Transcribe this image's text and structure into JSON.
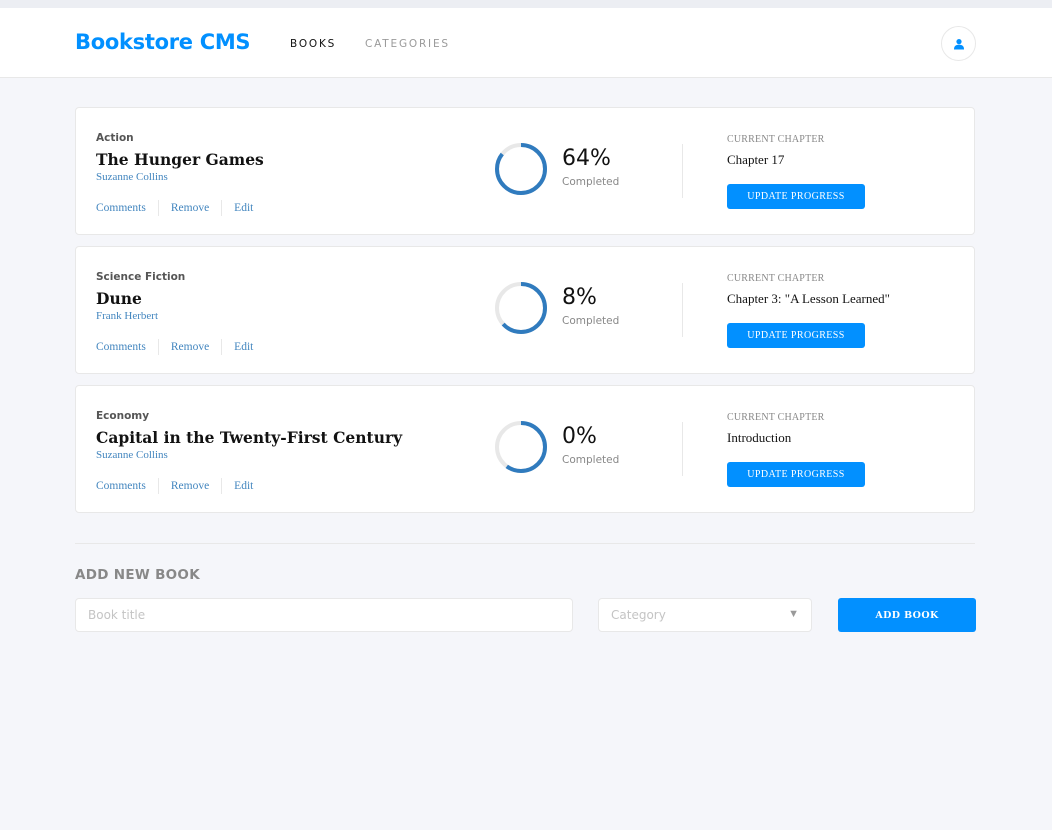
{
  "header": {
    "logo": "Bookstore CMS",
    "nav": [
      {
        "label": "BOOKS",
        "active": true
      },
      {
        "label": "CATEGORIES",
        "active": false
      }
    ],
    "avatar_icon": "user-icon"
  },
  "books": [
    {
      "category": "Action",
      "title": "The Hunger Games",
      "author": "Suzanne Collins",
      "actions": [
        "Comments",
        "Remove",
        "Edit"
      ],
      "progress": 64,
      "percent_label": "64%",
      "completed_label": "Completed",
      "chapter_label": "CURRENT CHAPTER",
      "chapter": "Chapter 17",
      "update_label": "UPDATE PROGRESS"
    },
    {
      "category": "Science Fiction",
      "title": "Dune",
      "author": "Frank Herbert",
      "actions": [
        "Comments",
        "Remove",
        "Edit"
      ],
      "progress": 8,
      "percent_label": "8%",
      "completed_label": "Completed",
      "chapter_label": "CURRENT CHAPTER",
      "chapter": "Chapter 3: \"A Lesson Learned\"",
      "update_label": "UPDATE PROGRESS"
    },
    {
      "category": "Economy",
      "title": "Capital in the Twenty-First Century",
      "author": "Suzanne Collins",
      "actions": [
        "Comments",
        "Remove",
        "Edit"
      ],
      "progress": 0,
      "percent_label": "0%",
      "completed_label": "Completed",
      "chapter_label": "CURRENT CHAPTER",
      "chapter": "Introduction",
      "update_label": "UPDATE PROGRESS"
    }
  ],
  "add_form": {
    "heading": "ADD NEW BOOK",
    "title_placeholder": "Book title",
    "category_placeholder": "Category",
    "submit_label": "ADD BOOK"
  },
  "colors": {
    "accent": "#0290ff",
    "link": "#4386bf",
    "ring_track": "#e8e8e8",
    "ring_fill": "#307bbe",
    "background": "#f5f6fa"
  }
}
